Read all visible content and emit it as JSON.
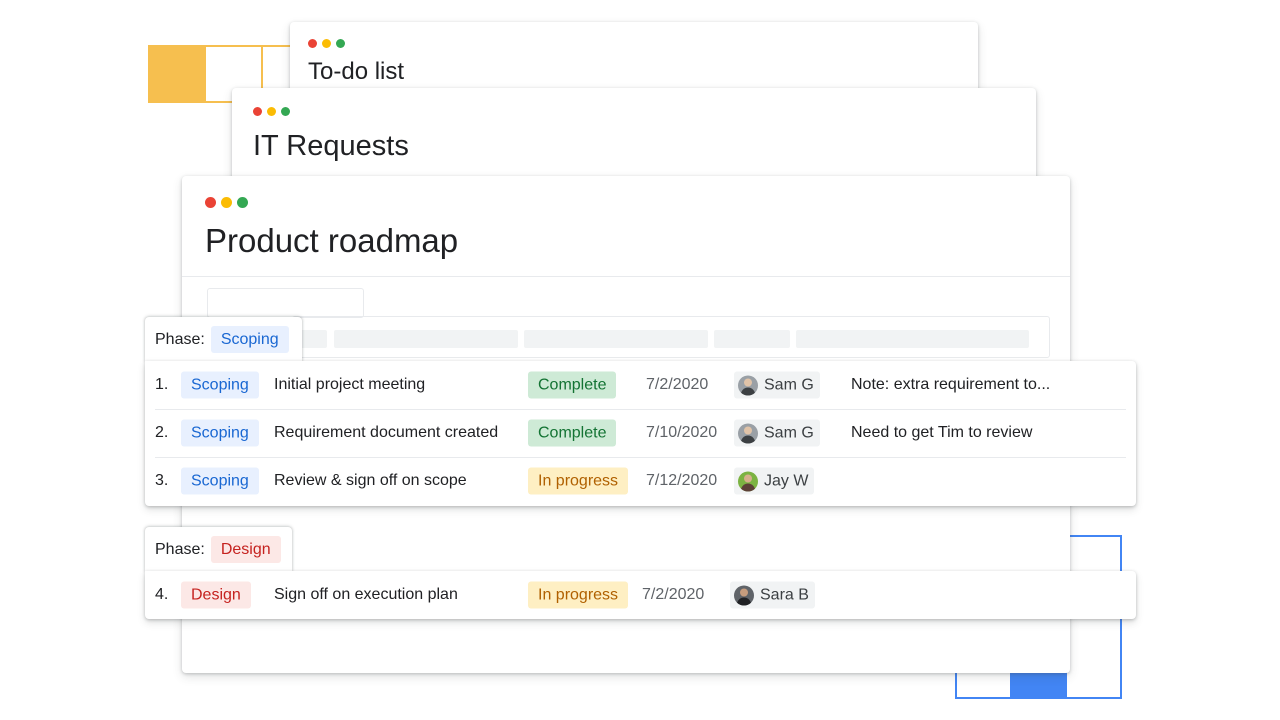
{
  "colors": {
    "dot_red": "#ea4335",
    "dot_yellow": "#fbbc04",
    "dot_green": "#34a853",
    "accent_yellow": "#f6bf4f",
    "accent_blue": "#4285f4",
    "scoping_bg": "#e8f0fe",
    "scoping_fg": "#1967d2",
    "design_bg": "#fce8e6",
    "design_fg": "#c5221f",
    "complete_bg": "#ceead6",
    "complete_fg": "#137333",
    "in_progress_bg": "#feefc3",
    "in_progress_fg": "#b06000"
  },
  "windows": {
    "todo": {
      "title": "To-do list"
    },
    "it": {
      "title": "IT Requests"
    },
    "roadmap": {
      "title": "Product roadmap"
    }
  },
  "groups": [
    {
      "phase_label": "Phase:",
      "phase": "Scoping",
      "rows": [
        {
          "num": "1.",
          "phase": "Scoping",
          "task": "Initial project meeting",
          "status": "Complete",
          "date": "7/2/2020",
          "assignee": "Sam G",
          "note": "Note: extra requirement to..."
        },
        {
          "num": "2.",
          "phase": "Scoping",
          "task": "Requirement document created",
          "status": "Complete",
          "date": "7/10/2020",
          "assignee": "Sam G",
          "note": "Need to get Tim to review"
        },
        {
          "num": "3.",
          "phase": "Scoping",
          "task": "Review & sign off on scope",
          "status": "In progress",
          "date": "7/12/2020",
          "assignee": "Jay W",
          "note": ""
        }
      ]
    },
    {
      "phase_label": "Phase:",
      "phase": "Design",
      "rows": [
        {
          "num": "4.",
          "phase": "Design",
          "task": "Sign off on execution plan",
          "status": "In progress",
          "date": "7/2/2020",
          "assignee": "Sara B",
          "note": ""
        }
      ]
    }
  ]
}
